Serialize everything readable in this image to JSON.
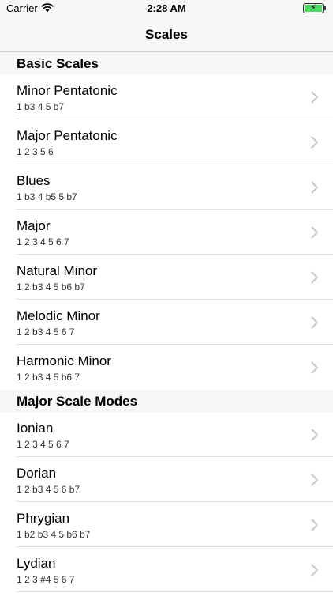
{
  "status_bar": {
    "carrier": "Carrier",
    "time": "2:28 AM"
  },
  "nav": {
    "title": "Scales"
  },
  "sections": [
    {
      "header": "Basic Scales",
      "rows": [
        {
          "title": "Minor Pentatonic",
          "notes": "1 b3 4 5 b7"
        },
        {
          "title": "Major Pentatonic",
          "notes": "1 2 3 5 6"
        },
        {
          "title": "Blues",
          "notes": "1 b3 4 b5 5 b7"
        },
        {
          "title": "Major",
          "notes": "1 2 3 4 5 6 7"
        },
        {
          "title": "Natural Minor",
          "notes": "1 2 b3 4 5 b6 b7"
        },
        {
          "title": "Melodic Minor",
          "notes": "1 2 b3 4 5 6 7"
        },
        {
          "title": "Harmonic Minor",
          "notes": "1 2 b3 4 5 b6 7"
        }
      ]
    },
    {
      "header": "Major Scale Modes",
      "rows": [
        {
          "title": "Ionian",
          "notes": "1 2 3 4 5 6 7"
        },
        {
          "title": "Dorian",
          "notes": "1 2 b3 4 5 6 b7"
        },
        {
          "title": "Phrygian",
          "notes": "1 b2 b3 4 5 b6 b7"
        },
        {
          "title": "Lydian",
          "notes": "1 2 3 #4 5 6 7"
        }
      ]
    }
  ],
  "colors": {
    "battery": "#4cd964",
    "chevron": "#c7c7cc",
    "bar_bg": "#f7f7f7"
  }
}
